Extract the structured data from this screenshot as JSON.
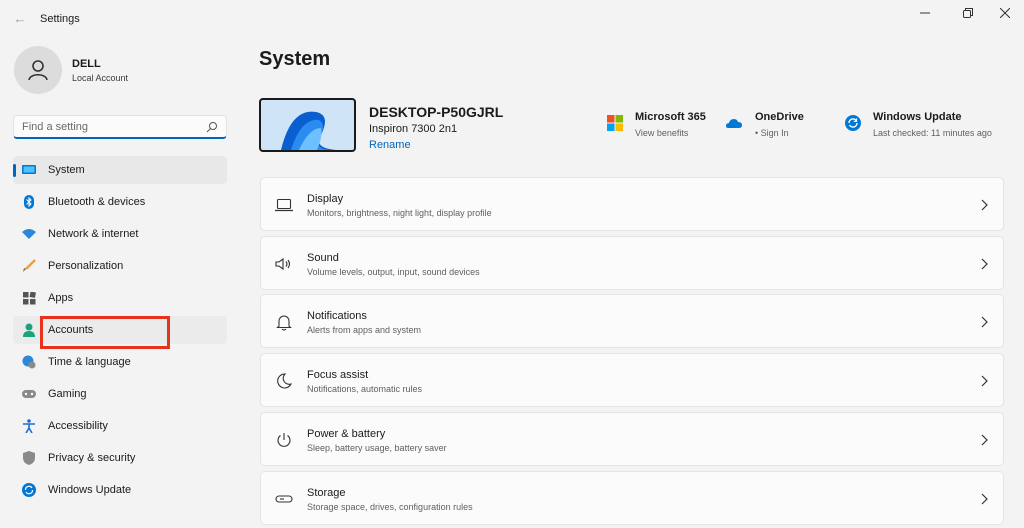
{
  "window": {
    "title": "Settings",
    "back_icon": "back-arrow-icon",
    "minimize_icon": "minimize-icon",
    "restore_icon": "restore-icon",
    "close_icon": "close-icon"
  },
  "user": {
    "name": "DELL",
    "account_type": "Local Account"
  },
  "search": {
    "placeholder": "Find a setting"
  },
  "sidebar": {
    "accent": "#0067c0",
    "items": [
      {
        "label": "System",
        "icon": "monitor-icon",
        "selected": true
      },
      {
        "label": "Bluetooth & devices",
        "icon": "bluetooth-icon"
      },
      {
        "label": "Network & internet",
        "icon": "wifi-icon"
      },
      {
        "label": "Personalization",
        "icon": "paintbrush-icon"
      },
      {
        "label": "Apps",
        "icon": "apps-grid-icon"
      },
      {
        "label": "Accounts",
        "icon": "person-icon",
        "highlighted": true
      },
      {
        "label": "Time & language",
        "icon": "globe-clock-icon"
      },
      {
        "label": "Gaming",
        "icon": "gamepad-icon"
      },
      {
        "label": "Accessibility",
        "icon": "accessibility-icon"
      },
      {
        "label": "Privacy & security",
        "icon": "shield-icon"
      },
      {
        "label": "Windows Update",
        "icon": "sync-icon"
      }
    ],
    "highlight_color": "#e8321e"
  },
  "main": {
    "title": "System",
    "device": {
      "name": "DESKTOP-P50GJRL",
      "model": "Inspiron 7300 2n1",
      "rename_label": "Rename"
    },
    "tiles": [
      {
        "title": "Microsoft 365",
        "subtitle": "View benefits",
        "icon": "microsoft-logo-icon"
      },
      {
        "title": "OneDrive",
        "subtitle": "• Sign In",
        "icon": "onedrive-cloud-icon"
      },
      {
        "title": "Windows Update",
        "subtitle": "Last checked: 11 minutes ago",
        "icon": "windows-update-icon"
      }
    ],
    "cards": [
      {
        "title": "Display",
        "subtitle": "Monitors, brightness, night light, display profile",
        "icon": "laptop-icon"
      },
      {
        "title": "Sound",
        "subtitle": "Volume levels, output, input, sound devices",
        "icon": "speaker-icon"
      },
      {
        "title": "Notifications",
        "subtitle": "Alerts from apps and system",
        "icon": "bell-icon"
      },
      {
        "title": "Focus assist",
        "subtitle": "Notifications, automatic rules",
        "icon": "moon-icon"
      },
      {
        "title": "Power & battery",
        "subtitle": "Sleep, battery usage, battery saver",
        "icon": "power-icon"
      },
      {
        "title": "Storage",
        "subtitle": "Storage space, drives, configuration rules",
        "icon": "drive-icon"
      }
    ]
  }
}
